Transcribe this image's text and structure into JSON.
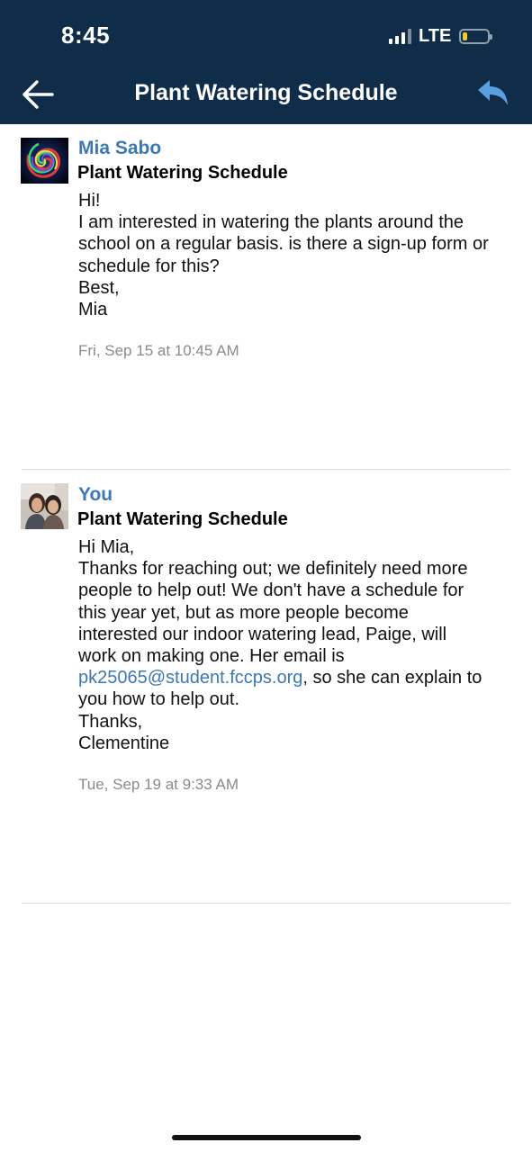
{
  "status_bar": {
    "time": "8:45",
    "network": "LTE",
    "signal_bars_active": 3,
    "signal_bars_total": 4,
    "battery_level": 0.2,
    "battery_color": "#f4d01e"
  },
  "header": {
    "title": "Plant Watering Schedule",
    "back_icon": "back-arrow-icon",
    "reply_icon": "reply-icon",
    "background": "#0f2d48",
    "accent": "#5aa0e0"
  },
  "messages": [
    {
      "sender": "Mia Sabo",
      "subject": "Plant Watering Schedule",
      "avatar": "swirl-avatar",
      "body_lines": [
        "Hi!",
        "I am interested in watering the plants around the",
        "school on a regular basis. is there a sign-up form or",
        "schedule for this?",
        "Best,",
        "Mia"
      ],
      "timestamp": "Fri, Sep 15 at 10:45 AM"
    },
    {
      "sender": "You",
      "subject": "Plant Watering Schedule",
      "avatar": "photo-avatar",
      "body_lines": [
        "Hi Mia,",
        "Thanks for reaching out; we definitely need more",
        "people to help out! We don't have a schedule for",
        "this year yet, but as more people become",
        "interested our indoor watering lead, Paige, will",
        "work on making one. Her email is"
      ],
      "email_link": "pk25065@student.fccps.org",
      "email_line_suffix": ", so she can explain to",
      "body_lines_after": [
        "you how to help out.",
        "Thanks,",
        "Clementine"
      ],
      "timestamp": "Tue, Sep 19 at 9:33 AM"
    }
  ]
}
